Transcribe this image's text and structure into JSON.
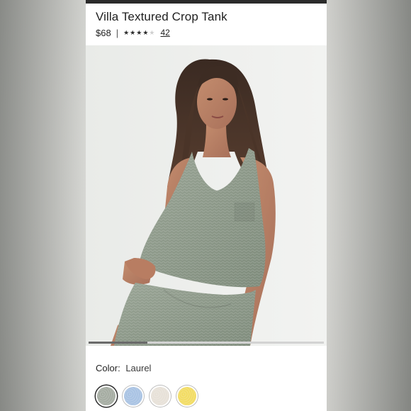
{
  "product": {
    "title": "Villa Textured Crop Tank",
    "price": "$68",
    "separator": "|",
    "rating": {
      "value": 4,
      "max": 5,
      "icon": "star-icon"
    },
    "review_count": "42"
  },
  "gallery": {
    "image_alt": "Model wearing sage green textured crop tank and matching shorts",
    "current_slide_fraction": 0.25
  },
  "color": {
    "label": "Color:",
    "selected": "Laurel",
    "swatches": [
      {
        "name": "Laurel",
        "color": "#a5aca2",
        "selected": true
      },
      {
        "name": "Light blue",
        "color": "#a9c3e3",
        "selected": false
      },
      {
        "name": "Natural",
        "color": "#e7e1d8",
        "selected": false
      },
      {
        "name": "Yellow",
        "color": "#f2dc64",
        "selected": false
      }
    ]
  },
  "colors": {
    "tank_green": "#8e9a8b",
    "text": "#1f1f1f",
    "top_strip": "#2b2b2b"
  }
}
